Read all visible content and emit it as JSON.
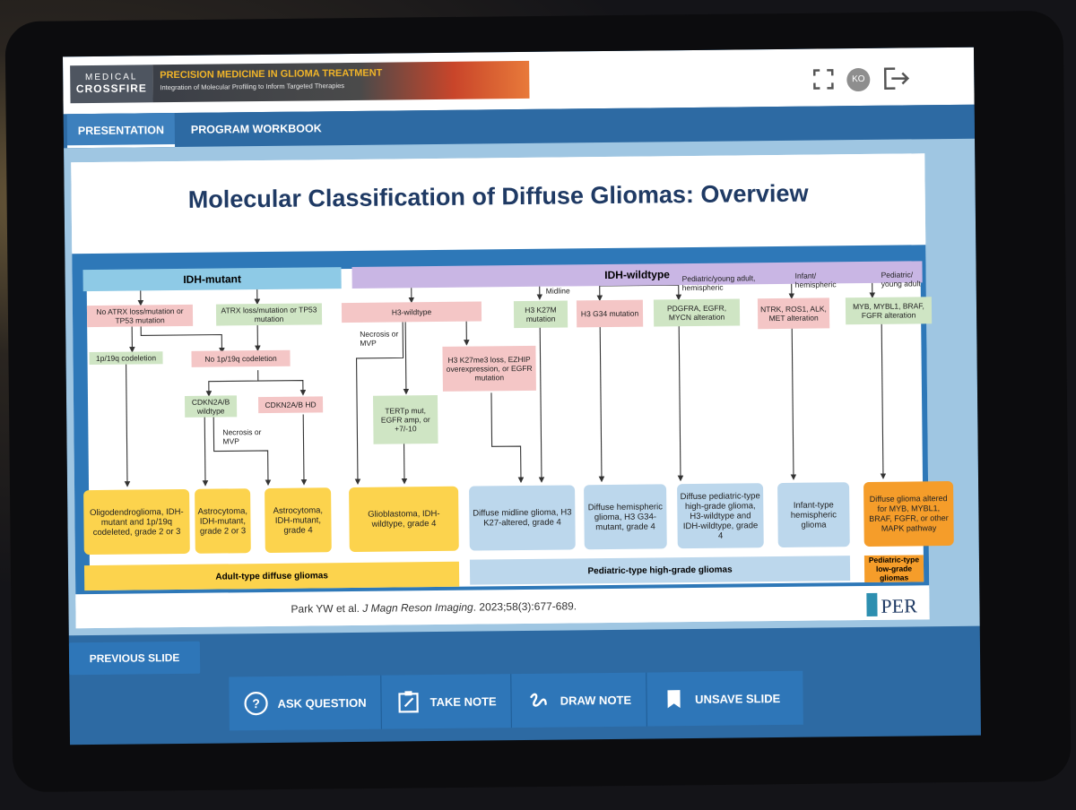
{
  "header": {
    "logo_line1": "MEDICAL",
    "logo_line2": "CROSSFIRE",
    "program_title": "PRECISION MEDICINE IN GLIOMA TREATMENT",
    "program_subtitle": "Integration of Molecular Profiling to Inform Targeted Therapies",
    "avatar_initials": "KO"
  },
  "tabs": [
    {
      "label": "PRESENTATION"
    },
    {
      "label": "PROGRAM WORKBOOK"
    }
  ],
  "slide": {
    "title": "Molecular Classification of Diffuse Gliomas: Overview",
    "citation_authors": "Park YW et al. ",
    "citation_journal": "J Magn Reson Imaging",
    "citation_rest": ". 2023;58(3):677-689.",
    "publisher_logo": "PER",
    "headers": {
      "idh_mutant": "IDH-mutant",
      "idh_wildtype": "IDH-wildtype"
    },
    "nodes": {
      "no_atrx": "No ATRX loss/mutation or TP53 mutation",
      "atrx": "ATRX loss/mutation or TP53 mutation",
      "codel": "1p/19q codeletion",
      "no_codel": "No 1p/19q codeletion",
      "cdkn_wt": "CDKN2A/B wildtype",
      "cdkn_hd": "CDKN2A/B HD",
      "h3_wt": "H3-wildtype",
      "h3k27m": "H3 K27M mutation",
      "h3g34": "H3 G34 mutation",
      "pdgfra": "PDGFRA, EGFR, MYCN alteration",
      "ntrk": "NTRK, ROS1, ALK, MET alteration",
      "myb": "MYB, MYBL1, BRAF, FGFR alteration",
      "h3k27me3": "H3 K27me3 loss, EZHIP overexpression, or EGFR mutation",
      "tert": "TERTp mut, EGFR amp, or +7/-10"
    },
    "labels": {
      "necrosis1": "Necrosis or MVP",
      "necrosis2": "Necrosis or MVP",
      "midline": "Midline",
      "ped_young_hemi": "Pediatric/young adult, hemispheric",
      "infant_hemi": "Infant/ hemispheric",
      "ped_young": "Pediatric/ young adult"
    },
    "outcomes": {
      "oligo": "Oligodendroglioma, IDH-mutant and 1p/19q codeleted, grade 2 or 3",
      "astro23": "Astrocytoma, IDH-mutant, grade 2 or 3",
      "astro4": "Astrocytoma, IDH-mutant, grade 4",
      "gbm": "Glioblastoma, IDH-wildtype, grade 4",
      "dmg": "Diffuse midline glioma, H3 K27-altered, grade 4",
      "dhg": "Diffuse hemispheric glioma, H3 G34-mutant, grade 4",
      "dphgg": "Diffuse pediatric-type high-grade glioma, H3-wildtype and IDH-wildtype, grade 4",
      "infant": "Infant-type hemispheric glioma",
      "dga": "Diffuse glioma altered for MYB, MYBL1, BRAF, FGFR, or other MAPK pathway"
    },
    "footers": {
      "adult": "Adult-type diffuse gliomas",
      "ped_hg": "Pediatric-type high-grade gliomas",
      "ped_lg": "Pediatric-type low-grade gliomas"
    },
    "colors": {
      "idh_mutant": "#8ecae6",
      "idh_wildtype": "#c9b6e4",
      "pink": "#f4c6c6",
      "green": "#cfe5c4",
      "yellow": "#fcd34d",
      "blue": "#bcd7ec",
      "orange": "#f59d2a"
    }
  },
  "controls": {
    "previous": "PREVIOUS SLIDE",
    "ask": "ASK QUESTION",
    "take_note": "TAKE NOTE",
    "draw_note": "DRAW NOTE",
    "unsave": "UNSAVE SLIDE"
  }
}
